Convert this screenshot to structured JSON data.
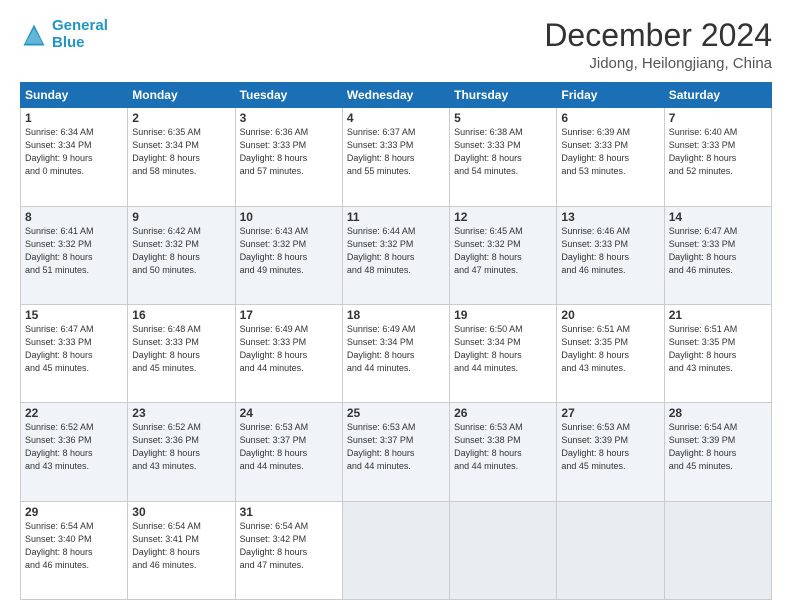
{
  "header": {
    "logo_line1": "General",
    "logo_line2": "Blue",
    "main_title": "December 2024",
    "subtitle": "Jidong, Heilongjiang, China"
  },
  "weekdays": [
    "Sunday",
    "Monday",
    "Tuesday",
    "Wednesday",
    "Thursday",
    "Friday",
    "Saturday"
  ],
  "weeks": [
    [
      {
        "day": "1",
        "info": "Sunrise: 6:34 AM\nSunset: 3:34 PM\nDaylight: 9 hours\nand 0 minutes."
      },
      {
        "day": "2",
        "info": "Sunrise: 6:35 AM\nSunset: 3:34 PM\nDaylight: 8 hours\nand 58 minutes."
      },
      {
        "day": "3",
        "info": "Sunrise: 6:36 AM\nSunset: 3:33 PM\nDaylight: 8 hours\nand 57 minutes."
      },
      {
        "day": "4",
        "info": "Sunrise: 6:37 AM\nSunset: 3:33 PM\nDaylight: 8 hours\nand 55 minutes."
      },
      {
        "day": "5",
        "info": "Sunrise: 6:38 AM\nSunset: 3:33 PM\nDaylight: 8 hours\nand 54 minutes."
      },
      {
        "day": "6",
        "info": "Sunrise: 6:39 AM\nSunset: 3:33 PM\nDaylight: 8 hours\nand 53 minutes."
      },
      {
        "day": "7",
        "info": "Sunrise: 6:40 AM\nSunset: 3:33 PM\nDaylight: 8 hours\nand 52 minutes."
      }
    ],
    [
      {
        "day": "8",
        "info": "Sunrise: 6:41 AM\nSunset: 3:32 PM\nDaylight: 8 hours\nand 51 minutes."
      },
      {
        "day": "9",
        "info": "Sunrise: 6:42 AM\nSunset: 3:32 PM\nDaylight: 8 hours\nand 50 minutes."
      },
      {
        "day": "10",
        "info": "Sunrise: 6:43 AM\nSunset: 3:32 PM\nDaylight: 8 hours\nand 49 minutes."
      },
      {
        "day": "11",
        "info": "Sunrise: 6:44 AM\nSunset: 3:32 PM\nDaylight: 8 hours\nand 48 minutes."
      },
      {
        "day": "12",
        "info": "Sunrise: 6:45 AM\nSunset: 3:32 PM\nDaylight: 8 hours\nand 47 minutes."
      },
      {
        "day": "13",
        "info": "Sunrise: 6:46 AM\nSunset: 3:33 PM\nDaylight: 8 hours\nand 46 minutes."
      },
      {
        "day": "14",
        "info": "Sunrise: 6:47 AM\nSunset: 3:33 PM\nDaylight: 8 hours\nand 46 minutes."
      }
    ],
    [
      {
        "day": "15",
        "info": "Sunrise: 6:47 AM\nSunset: 3:33 PM\nDaylight: 8 hours\nand 45 minutes."
      },
      {
        "day": "16",
        "info": "Sunrise: 6:48 AM\nSunset: 3:33 PM\nDaylight: 8 hours\nand 45 minutes."
      },
      {
        "day": "17",
        "info": "Sunrise: 6:49 AM\nSunset: 3:33 PM\nDaylight: 8 hours\nand 44 minutes."
      },
      {
        "day": "18",
        "info": "Sunrise: 6:49 AM\nSunset: 3:34 PM\nDaylight: 8 hours\nand 44 minutes."
      },
      {
        "day": "19",
        "info": "Sunrise: 6:50 AM\nSunset: 3:34 PM\nDaylight: 8 hours\nand 44 minutes."
      },
      {
        "day": "20",
        "info": "Sunrise: 6:51 AM\nSunset: 3:35 PM\nDaylight: 8 hours\nand 43 minutes."
      },
      {
        "day": "21",
        "info": "Sunrise: 6:51 AM\nSunset: 3:35 PM\nDaylight: 8 hours\nand 43 minutes."
      }
    ],
    [
      {
        "day": "22",
        "info": "Sunrise: 6:52 AM\nSunset: 3:36 PM\nDaylight: 8 hours\nand 43 minutes."
      },
      {
        "day": "23",
        "info": "Sunrise: 6:52 AM\nSunset: 3:36 PM\nDaylight: 8 hours\nand 43 minutes."
      },
      {
        "day": "24",
        "info": "Sunrise: 6:53 AM\nSunset: 3:37 PM\nDaylight: 8 hours\nand 44 minutes."
      },
      {
        "day": "25",
        "info": "Sunrise: 6:53 AM\nSunset: 3:37 PM\nDaylight: 8 hours\nand 44 minutes."
      },
      {
        "day": "26",
        "info": "Sunrise: 6:53 AM\nSunset: 3:38 PM\nDaylight: 8 hours\nand 44 minutes."
      },
      {
        "day": "27",
        "info": "Sunrise: 6:53 AM\nSunset: 3:39 PM\nDaylight: 8 hours\nand 45 minutes."
      },
      {
        "day": "28",
        "info": "Sunrise: 6:54 AM\nSunset: 3:39 PM\nDaylight: 8 hours\nand 45 minutes."
      }
    ],
    [
      {
        "day": "29",
        "info": "Sunrise: 6:54 AM\nSunset: 3:40 PM\nDaylight: 8 hours\nand 46 minutes."
      },
      {
        "day": "30",
        "info": "Sunrise: 6:54 AM\nSunset: 3:41 PM\nDaylight: 8 hours\nand 46 minutes."
      },
      {
        "day": "31",
        "info": "Sunrise: 6:54 AM\nSunset: 3:42 PM\nDaylight: 8 hours\nand 47 minutes."
      },
      null,
      null,
      null,
      null
    ]
  ]
}
